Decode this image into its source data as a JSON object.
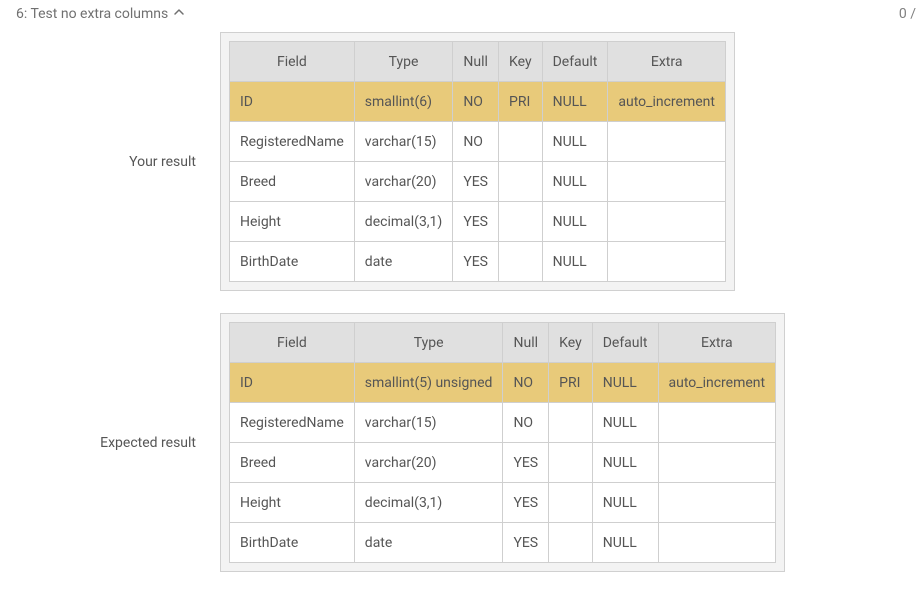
{
  "header": {
    "title": "6: Test no extra columns",
    "score": "0 /"
  },
  "your": {
    "label": "Your result",
    "columns": [
      "Field",
      "Type",
      "Null",
      "Key",
      "Default",
      "Extra"
    ],
    "rows": [
      {
        "hl": true,
        "cells": [
          "ID",
          "smallint(6)",
          "NO",
          "PRI",
          "NULL",
          "auto_increment"
        ]
      },
      {
        "hl": false,
        "cells": [
          "RegisteredName",
          "varchar(15)",
          "NO",
          "",
          "NULL",
          ""
        ]
      },
      {
        "hl": false,
        "cells": [
          "Breed",
          "varchar(20)",
          "YES",
          "",
          "NULL",
          ""
        ]
      },
      {
        "hl": false,
        "cells": [
          "Height",
          "decimal(3,1)",
          "YES",
          "",
          "NULL",
          ""
        ]
      },
      {
        "hl": false,
        "cells": [
          "BirthDate",
          "date",
          "YES",
          "",
          "NULL",
          ""
        ]
      }
    ]
  },
  "expected": {
    "label": "Expected result",
    "columns": [
      "Field",
      "Type",
      "Null",
      "Key",
      "Default",
      "Extra"
    ],
    "rows": [
      {
        "hl": true,
        "cells": [
          "ID",
          "smallint(5) unsigned",
          "NO",
          "PRI",
          "NULL",
          "auto_increment"
        ]
      },
      {
        "hl": false,
        "cells": [
          "RegisteredName",
          "varchar(15)",
          "NO",
          "",
          "NULL",
          ""
        ]
      },
      {
        "hl": false,
        "cells": [
          "Breed",
          "varchar(20)",
          "YES",
          "",
          "NULL",
          ""
        ]
      },
      {
        "hl": false,
        "cells": [
          "Height",
          "decimal(3,1)",
          "YES",
          "",
          "NULL",
          ""
        ]
      },
      {
        "hl": false,
        "cells": [
          "BirthDate",
          "date",
          "YES",
          "",
          "NULL",
          ""
        ]
      }
    ]
  }
}
